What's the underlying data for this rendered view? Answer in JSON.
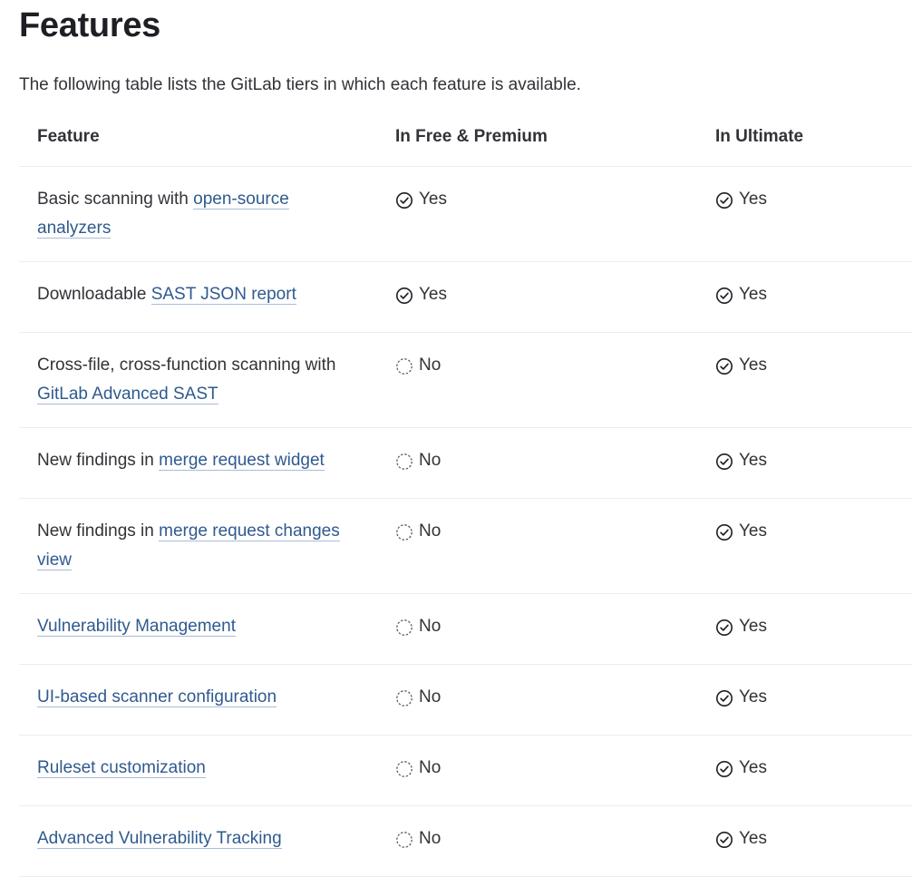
{
  "page": {
    "title": "Features",
    "intro": "The following table lists the GitLab tiers in which each feature is available."
  },
  "table": {
    "headers": [
      "Feature",
      "In Free & Premium",
      "In Ultimate"
    ],
    "rows": [
      {
        "feature": {
          "prefix": "Basic scanning with ",
          "link": "open-source analyzers"
        },
        "free": {
          "icon": "check-circle-icon",
          "label": "Yes"
        },
        "ultimate": {
          "icon": "check-circle-icon",
          "label": "Yes"
        }
      },
      {
        "feature": {
          "prefix": "Downloadable ",
          "link": "SAST JSON report"
        },
        "free": {
          "icon": "check-circle-icon",
          "label": "Yes"
        },
        "ultimate": {
          "icon": "check-circle-icon",
          "label": "Yes"
        }
      },
      {
        "feature": {
          "prefix": "Cross-file, cross-function scanning with ",
          "link": "GitLab Advanced SAST"
        },
        "free": {
          "icon": "dashed-circle-icon",
          "label": "No"
        },
        "ultimate": {
          "icon": "check-circle-icon",
          "label": "Yes"
        }
      },
      {
        "feature": {
          "prefix": "New findings in ",
          "link": "merge request widget"
        },
        "free": {
          "icon": "dashed-circle-icon",
          "label": "No"
        },
        "ultimate": {
          "icon": "check-circle-icon",
          "label": "Yes"
        }
      },
      {
        "feature": {
          "prefix": "New findings in ",
          "link": "merge request changes view"
        },
        "free": {
          "icon": "dashed-circle-icon",
          "label": "No"
        },
        "ultimate": {
          "icon": "check-circle-icon",
          "label": "Yes"
        }
      },
      {
        "feature": {
          "prefix": "",
          "link": "Vulnerability Management"
        },
        "free": {
          "icon": "dashed-circle-icon",
          "label": "No"
        },
        "ultimate": {
          "icon": "check-circle-icon",
          "label": "Yes"
        }
      },
      {
        "feature": {
          "prefix": "",
          "link": "UI-based scanner configuration"
        },
        "free": {
          "icon": "dashed-circle-icon",
          "label": "No"
        },
        "ultimate": {
          "icon": "check-circle-icon",
          "label": "Yes"
        }
      },
      {
        "feature": {
          "prefix": "",
          "link": "Ruleset customization"
        },
        "free": {
          "icon": "dashed-circle-icon",
          "label": "No"
        },
        "ultimate": {
          "icon": "check-circle-icon",
          "label": "Yes"
        }
      },
      {
        "feature": {
          "prefix": "",
          "link": "Advanced Vulnerability Tracking"
        },
        "free": {
          "icon": "dashed-circle-icon",
          "label": "No"
        },
        "ultimate": {
          "icon": "check-circle-icon",
          "label": "Yes"
        }
      }
    ]
  },
  "colors": {
    "text": "#333238",
    "heading": "#1f1e24",
    "link": "#2f5a8f",
    "link_underline": "#a9bcd6",
    "row_divider": "#ececef"
  }
}
